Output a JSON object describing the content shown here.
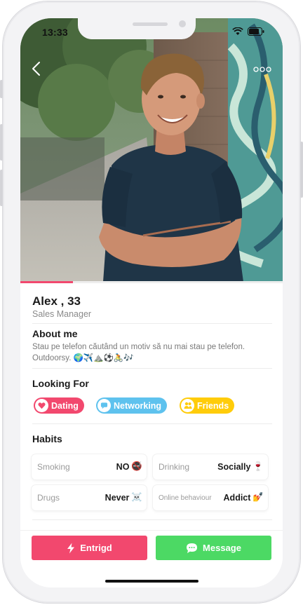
{
  "status_bar": {
    "time": "13:33"
  },
  "profile": {
    "name": "Alex",
    "age": "33",
    "job_title": "Sales Manager",
    "photo_progress": 0.2
  },
  "about": {
    "title": "About me",
    "text": "Stau pe telefon căutând un motiv să nu mai stau pe telefon. Outdoorsy. 🌍✈️⛰️⚽🚴🎶"
  },
  "looking_for": {
    "title": "Looking For",
    "chips": [
      {
        "label": "Dating",
        "color": "#f2486e",
        "icon": "heart-icon"
      },
      {
        "label": "Networking",
        "color": "#5ec2ee",
        "icon": "chat-icon"
      },
      {
        "label": "Friends",
        "color": "#ffcc0a",
        "icon": "people-icon"
      }
    ]
  },
  "habits": {
    "title": "Habits",
    "items": [
      {
        "label": "Smoking",
        "value": "NO",
        "emoji": "🚭"
      },
      {
        "label": "Drinking",
        "value": "Socially",
        "emoji": "🍷"
      },
      {
        "label": "Drugs",
        "value": "Never",
        "emoji": "☠️"
      },
      {
        "label": "Online behaviour",
        "value": "Addict",
        "emoji": "💅"
      }
    ]
  },
  "actions": {
    "entrigd_label": "Entrigd",
    "entrigd_color": "#f2486e",
    "message_label": "Message",
    "message_color": "#4cd964"
  }
}
